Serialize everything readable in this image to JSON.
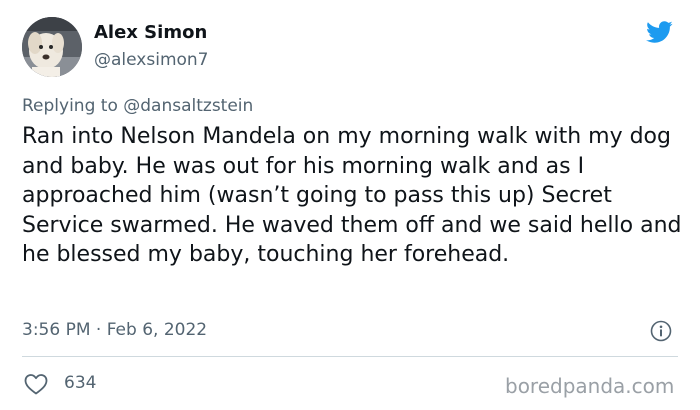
{
  "author": {
    "name": "Alex Simon",
    "handle": "@alexsimon7",
    "avatar_icon": "dog-avatar"
  },
  "reply": {
    "prefix": "Replying to ",
    "handle": "@dansaltzstein"
  },
  "tweet": {
    "text": "Ran into Nelson Mandela on my morning walk with my dog and baby. He was out for his morning walk and as I approached him (wasn’t going to pass this up) Secret Service swarmed. He waved them off and we said hello and he blessed my baby, touching her forehead.",
    "timestamp": "3:56 PM · Feb 6, 2022"
  },
  "actions": {
    "like_count": "634"
  },
  "watermark": "boredpanda.com",
  "colors": {
    "twitter_blue": "#1d9bf0",
    "secondary_text": "#536471",
    "divider": "#cfd9de"
  }
}
